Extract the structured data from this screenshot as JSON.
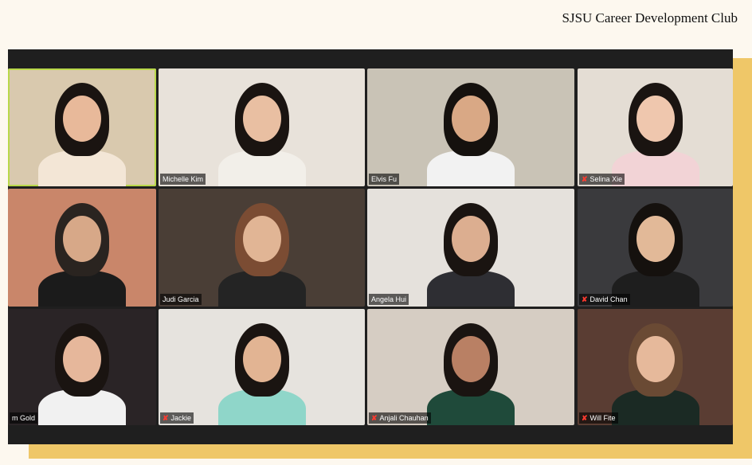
{
  "brand_title": "SJSU Career Development Club",
  "participants": [
    {
      "name": "",
      "active": true,
      "muted": false,
      "bg": "#d9c9ae",
      "hair": "#1a1411",
      "skin": "#e8b99a",
      "shirt": "#f3e6d6"
    },
    {
      "name": "Michelle Kim",
      "active": false,
      "muted": false,
      "bg": "#e8e2da",
      "hair": "#1a1411",
      "skin": "#e9bfa2",
      "shirt": "#f2efe9"
    },
    {
      "name": "Elvis Fu",
      "active": false,
      "muted": false,
      "bg": "#c9c3b6",
      "hair": "#15110e",
      "skin": "#d9a885",
      "shirt": "#f2f2f2"
    },
    {
      "name": "Selina Xie",
      "active": false,
      "muted": true,
      "bg": "#e4ddd4",
      "hair": "#1a1411",
      "skin": "#efc7ae",
      "shirt": "#f2d3d6"
    },
    {
      "name": "",
      "active": false,
      "muted": false,
      "bg": "#c9866a",
      "hair": "#2a2420",
      "skin": "#d7a888",
      "shirt": "#1b1b1b"
    },
    {
      "name": "Judi Garcia",
      "active": false,
      "muted": false,
      "bg": "#4a3e36",
      "hair": "#7b4c33",
      "skin": "#e1b595",
      "shirt": "#242424"
    },
    {
      "name": "Angela Hui",
      "active": false,
      "muted": false,
      "bg": "#e5e1dc",
      "hair": "#1a1411",
      "skin": "#dcae90",
      "shirt": "#2e2e33"
    },
    {
      "name": "David Chan",
      "active": false,
      "muted": true,
      "bg": "#3a3a3d",
      "hair": "#15110e",
      "skin": "#e2b998",
      "shirt": "#1e1e1e"
    },
    {
      "name": "m Gold",
      "active": false,
      "muted": false,
      "bg": "#2a2426",
      "hair": "#1a1411",
      "skin": "#e6b79b",
      "shirt": "#f1f1f1"
    },
    {
      "name": "Jackie",
      "active": false,
      "muted": true,
      "bg": "#e6e3de",
      "hair": "#1a1411",
      "skin": "#e2b493",
      "shirt": "#8fd6c9"
    },
    {
      "name": "Anjali Chauhan",
      "active": false,
      "muted": true,
      "bg": "#d6cdc3",
      "hair": "#1a1411",
      "skin": "#b98064",
      "shirt": "#1f4a3a"
    },
    {
      "name": "Will Fite",
      "active": false,
      "muted": true,
      "bg": "#5a3d33",
      "hair": "#6a4a34",
      "skin": "#e6b99b",
      "shirt": "#1b2a24"
    }
  ],
  "icons": {
    "mute": "mic-muted-icon"
  }
}
